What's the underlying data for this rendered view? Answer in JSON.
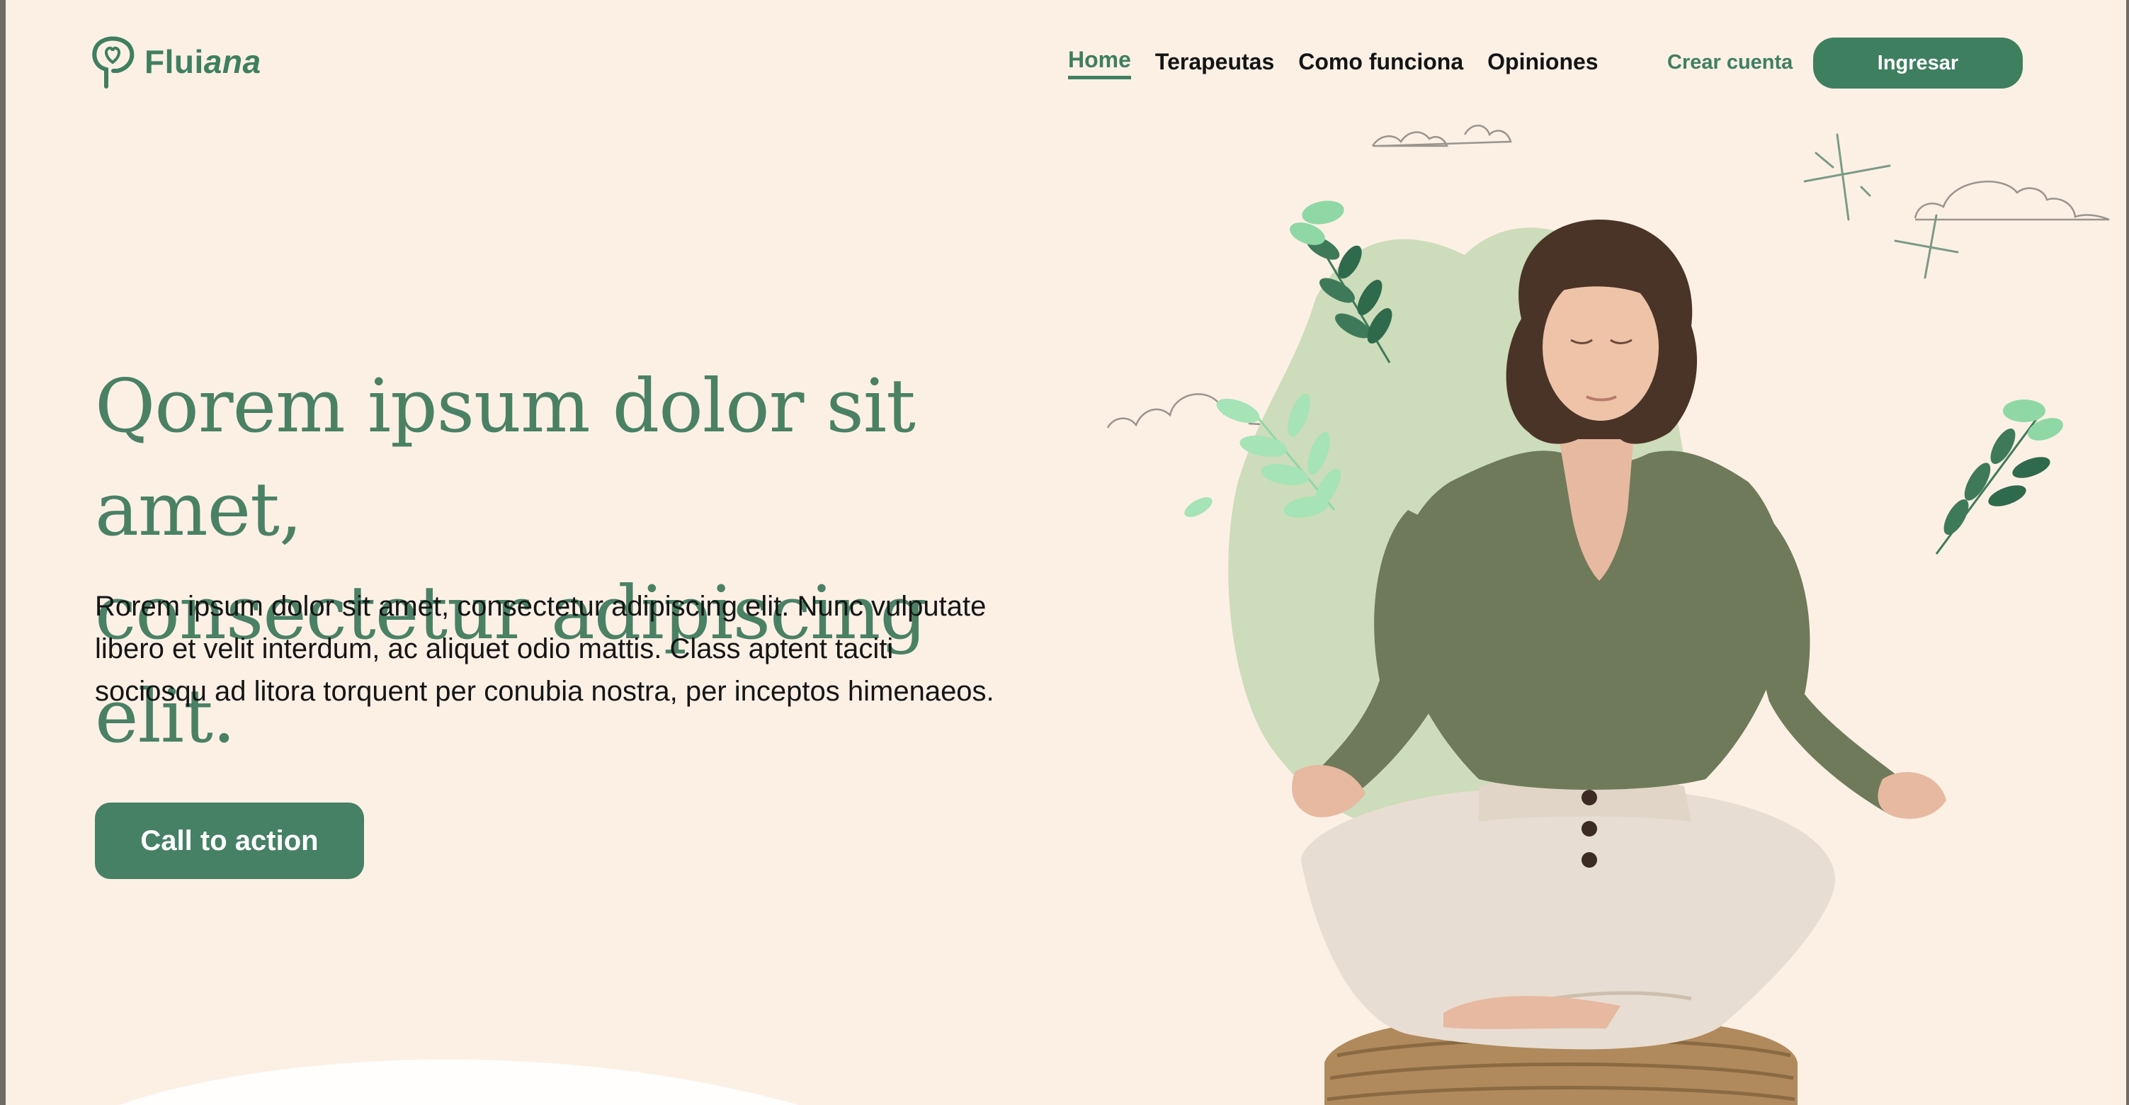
{
  "brand": {
    "name_prefix": "Flui",
    "name_suffix": "ana",
    "color": "#3e7f60"
  },
  "nav": {
    "items": [
      {
        "label": "Home",
        "active": true
      },
      {
        "label": "Terapeutas",
        "active": false
      },
      {
        "label": "Como funciona",
        "active": false
      },
      {
        "label": "Opiniones",
        "active": false
      }
    ],
    "signup_label": "Crear cuenta",
    "login_label": "Ingresar"
  },
  "hero": {
    "headline_line1": "Qorem ipsum dolor sit amet,",
    "headline_line2": "consectetur adipiscing elit.",
    "body": "Rorem ipsum dolor sit amet, consectetur adipiscing elit. Nunc vulputate libero et velit interdum, ac aliquet odio mattis. Class aptent taciti sociosqu ad litora torquent per conubia nostra, per inceptos himenaeos.",
    "cta_label": "Call to action"
  },
  "colors": {
    "background": "#fcf0e5",
    "accent": "#3e7f60",
    "blob": "#cddcba",
    "shirt": "#6f7a5a",
    "pants": "#e8ddd2"
  }
}
